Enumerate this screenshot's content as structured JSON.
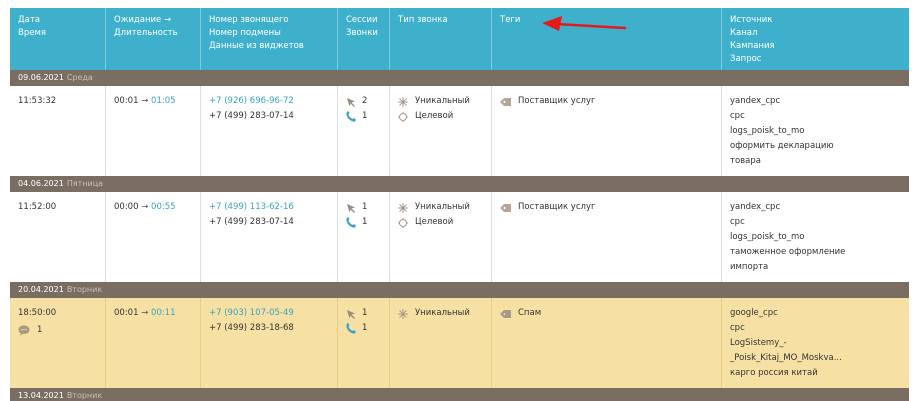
{
  "header": {
    "date": "Дата",
    "time": "Время",
    "wait": "Ожидание →",
    "duration": "Длительность",
    "caller": "Номер звонящего",
    "replace": "Номер подмены",
    "widgets": "Данные из виджетов",
    "sessions": "Сессии",
    "calls": "Звонки",
    "calltype": "Тип звонка",
    "tags": "Теги",
    "source": "Источник",
    "channel": "Канал",
    "campaign": "Кампания",
    "query": "Запрос"
  },
  "days": [
    {
      "date": "09.06.2021",
      "weekday": "Среда",
      "call": {
        "time": "11:53:32",
        "wait": "00:01",
        "arrow": "→",
        "duration": "01:05",
        "caller": "+7 (926) 696-96-72",
        "replace": "+7 (499) 283-07-14",
        "sessions": "2",
        "calls": "1",
        "types": [
          "Уникальный",
          "Целевой"
        ],
        "tag": "Поставщик услуг",
        "source": [
          "yandex_cpc",
          "cpc",
          "logs_poisk_to_mo",
          "оформить декларацию",
          "товара"
        ]
      }
    },
    {
      "date": "04.06.2021",
      "weekday": "Пятница",
      "call": {
        "time": "11:52:00",
        "wait": "00:00",
        "arrow": "→",
        "duration": "00:55",
        "caller": "+7 (499) 113-62-16",
        "replace": "+7 (499) 283-07-14",
        "sessions": "1",
        "calls": "1",
        "types": [
          "Уникальный",
          "Целевой"
        ],
        "tag": "Поставщик услуг",
        "source": [
          "yandex_cpc",
          "cpc",
          "logs_poisk_to_mo",
          "таможенное оформление",
          "импорта"
        ]
      }
    },
    {
      "date": "20.04.2021",
      "weekday": "Вторник",
      "call": {
        "time": "18:50:00",
        "comments": "1",
        "wait": "00:01",
        "arrow": "→",
        "duration": "00:11",
        "caller": "+7 (903) 107-05-49",
        "replace": "+7 (499) 283-18-68",
        "sessions": "1",
        "calls": "1",
        "types": [
          "Уникальный"
        ],
        "tag": "Спам",
        "source": [
          "google_cpc",
          "cpc",
          "LogSistemy_-",
          "_Poisk_Kitaj_MO_Moskva...",
          "карго россия китай"
        ]
      }
    },
    {
      "date": "13.04.2021",
      "weekday": "Вторник"
    }
  ],
  "colors": {
    "header": "#3fb0cc",
    "daybar": "#7a6e62",
    "highlight": "#f7e0a3",
    "link": "#3aa3c3",
    "annotation_arrow": "#e31b1b"
  }
}
